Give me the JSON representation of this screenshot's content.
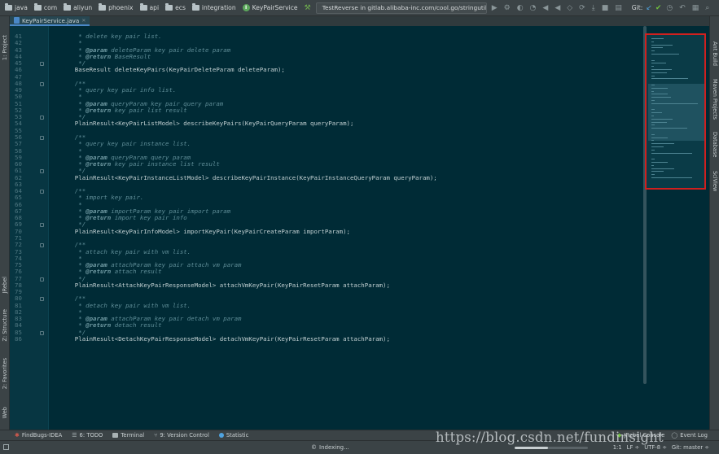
{
  "navbar": {
    "crumbs": [
      "java",
      "com",
      "aliyun",
      "phoenix",
      "api",
      "ecs",
      "integration"
    ],
    "interface": "KeyPairService",
    "run_config": "TestReverse in gitlab.alibaba-inc.com/cool.go/stringutil",
    "git_label": "Git:"
  },
  "tabs": [
    {
      "label": "KeyPairService.java"
    }
  ],
  "left_tools": {
    "project": "1: Project",
    "jrebel": "JRebel",
    "structure": "Z: Structure",
    "favorites": "2: Favorites",
    "web": "Web"
  },
  "right_tools": {
    "ant": "Ant Build",
    "maven": "Maven Projects",
    "database": "Database",
    "sciview": "SciView"
  },
  "code_lines": [
    {
      "n": "41",
      "parts": [
        [
          "doc",
          "     * delete key pair list."
        ]
      ]
    },
    {
      "n": "42",
      "parts": [
        [
          "doc",
          "     *"
        ]
      ]
    },
    {
      "n": "43",
      "parts": [
        [
          "doc",
          "     * "
        ],
        [
          "tag",
          "@param"
        ],
        [
          "doc",
          " deleteParam key pair delete param"
        ]
      ]
    },
    {
      "n": "44",
      "parts": [
        [
          "doc",
          "     * "
        ],
        [
          "tag",
          "@return"
        ],
        [
          "doc",
          " BaseResult"
        ]
      ]
    },
    {
      "n": "45",
      "parts": [
        [
          "doc",
          "     */"
        ]
      ]
    },
    {
      "n": "46",
      "parts": [
        [
          "code",
          "    BaseResult deleteKeyPairs(KeyPairDeleteParam deleteParam);"
        ]
      ]
    },
    {
      "n": "47",
      "parts": [
        [
          "code",
          ""
        ]
      ]
    },
    {
      "n": "48",
      "parts": [
        [
          "doc",
          "    /**"
        ]
      ]
    },
    {
      "n": "49",
      "parts": [
        [
          "doc",
          "     * query key pair info list."
        ]
      ]
    },
    {
      "n": "50",
      "parts": [
        [
          "doc",
          "     *"
        ]
      ]
    },
    {
      "n": "51",
      "parts": [
        [
          "doc",
          "     * "
        ],
        [
          "tag",
          "@param"
        ],
        [
          "doc",
          " queryParam key pair query param"
        ]
      ]
    },
    {
      "n": "52",
      "parts": [
        [
          "doc",
          "     * "
        ],
        [
          "tag",
          "@return"
        ],
        [
          "doc",
          " key pair list result"
        ]
      ]
    },
    {
      "n": "53",
      "parts": [
        [
          "doc",
          "     */"
        ]
      ]
    },
    {
      "n": "54",
      "parts": [
        [
          "code",
          "    PlainResult<KeyPairListModel> describeKeyPairs(KeyPairQueryParam queryParam);"
        ]
      ]
    },
    {
      "n": "55",
      "parts": [
        [
          "code",
          ""
        ]
      ]
    },
    {
      "n": "56",
      "parts": [
        [
          "doc",
          "    /**"
        ]
      ]
    },
    {
      "n": "57",
      "parts": [
        [
          "doc",
          "     * query key pair instance list."
        ]
      ]
    },
    {
      "n": "58",
      "parts": [
        [
          "doc",
          "     *"
        ]
      ]
    },
    {
      "n": "59",
      "parts": [
        [
          "doc",
          "     * "
        ],
        [
          "tag",
          "@param"
        ],
        [
          "doc",
          " queryParam query param"
        ]
      ]
    },
    {
      "n": "60",
      "parts": [
        [
          "doc",
          "     * "
        ],
        [
          "tag",
          "@return"
        ],
        [
          "doc",
          " key pair instance list result"
        ]
      ]
    },
    {
      "n": "61",
      "parts": [
        [
          "doc",
          "     */"
        ]
      ]
    },
    {
      "n": "62",
      "parts": [
        [
          "code",
          "    PlainResult<KeyPairInstanceListModel> describeKeyPairInstance(KeyPairInstanceQueryParam queryParam);"
        ]
      ]
    },
    {
      "n": "63",
      "parts": [
        [
          "code",
          ""
        ]
      ]
    },
    {
      "n": "64",
      "parts": [
        [
          "doc",
          "    /**"
        ]
      ]
    },
    {
      "n": "65",
      "parts": [
        [
          "doc",
          "     * import key pair."
        ]
      ]
    },
    {
      "n": "66",
      "parts": [
        [
          "doc",
          "     *"
        ]
      ]
    },
    {
      "n": "67",
      "parts": [
        [
          "doc",
          "     * "
        ],
        [
          "tag",
          "@param"
        ],
        [
          "doc",
          " importParam key pair import param"
        ]
      ]
    },
    {
      "n": "68",
      "parts": [
        [
          "doc",
          "     * "
        ],
        [
          "tag",
          "@return"
        ],
        [
          "doc",
          " import key pair info"
        ]
      ]
    },
    {
      "n": "69",
      "parts": [
        [
          "doc",
          "     */"
        ]
      ]
    },
    {
      "n": "70",
      "parts": [
        [
          "code",
          "    PlainResult<KeyPairInfoModel> importKeyPair(KeyPairCreateParam importParam);"
        ]
      ]
    },
    {
      "n": "71",
      "parts": [
        [
          "code",
          ""
        ]
      ]
    },
    {
      "n": "72",
      "parts": [
        [
          "doc",
          "    /**"
        ]
      ]
    },
    {
      "n": "73",
      "parts": [
        [
          "doc",
          "     * attach key pair with vm list."
        ]
      ]
    },
    {
      "n": "74",
      "parts": [
        [
          "doc",
          "     *"
        ]
      ]
    },
    {
      "n": "75",
      "parts": [
        [
          "doc",
          "     * "
        ],
        [
          "tag",
          "@param"
        ],
        [
          "doc",
          " attachParam key pair attach vm param"
        ]
      ]
    },
    {
      "n": "76",
      "parts": [
        [
          "doc",
          "     * "
        ],
        [
          "tag",
          "@return"
        ],
        [
          "doc",
          " attach result"
        ]
      ]
    },
    {
      "n": "77",
      "parts": [
        [
          "doc",
          "     */"
        ]
      ]
    },
    {
      "n": "78",
      "parts": [
        [
          "code",
          "    PlainResult<AttachKeyPairResponseModel> attachVmKeyPair(KeyPairResetParam attachParam);"
        ]
      ]
    },
    {
      "n": "79",
      "parts": [
        [
          "code",
          ""
        ]
      ]
    },
    {
      "n": "80",
      "parts": [
        [
          "doc",
          "    /**"
        ]
      ]
    },
    {
      "n": "81",
      "parts": [
        [
          "doc",
          "     * detach key pair with vm list."
        ]
      ]
    },
    {
      "n": "82",
      "parts": [
        [
          "doc",
          "     *"
        ]
      ]
    },
    {
      "n": "83",
      "parts": [
        [
          "doc",
          "     * "
        ],
        [
          "tag",
          "@param"
        ],
        [
          "doc",
          " attachParam key pair detach vm param"
        ]
      ]
    },
    {
      "n": "84",
      "parts": [
        [
          "doc",
          "     * "
        ],
        [
          "tag",
          "@return"
        ],
        [
          "doc",
          " detach result"
        ]
      ]
    },
    {
      "n": "85",
      "parts": [
        [
          "doc",
          "     */"
        ]
      ]
    },
    {
      "n": "86",
      "parts": [
        [
          "code",
          "    PlainResult<DetachKeyPairResponseModel> detachVmKeyPair(KeyPairResetParam attachParam);"
        ]
      ]
    }
  ],
  "bottom_tools": {
    "findbugs": "FindBugs-IDEA",
    "todo": "6: TODO",
    "terminal": "Terminal",
    "version_control": "9: Version Control",
    "statistic": "Statistic",
    "jrebel_console": "JRebel Console",
    "event_log": "Event Log"
  },
  "status": {
    "indexing": "Indexing...",
    "indexing_progress": 0.45,
    "position": "1:1",
    "line_sep": "LF ÷",
    "encoding": "UTF-8 ÷",
    "git_branch": "Git: master ÷"
  },
  "watermark": "https://blog.csdn.net/fundinsight",
  "colors": {
    "editor_bg": "#002b36",
    "minimap_highlight": "#d0201f",
    "accent": "#4a88c7"
  }
}
